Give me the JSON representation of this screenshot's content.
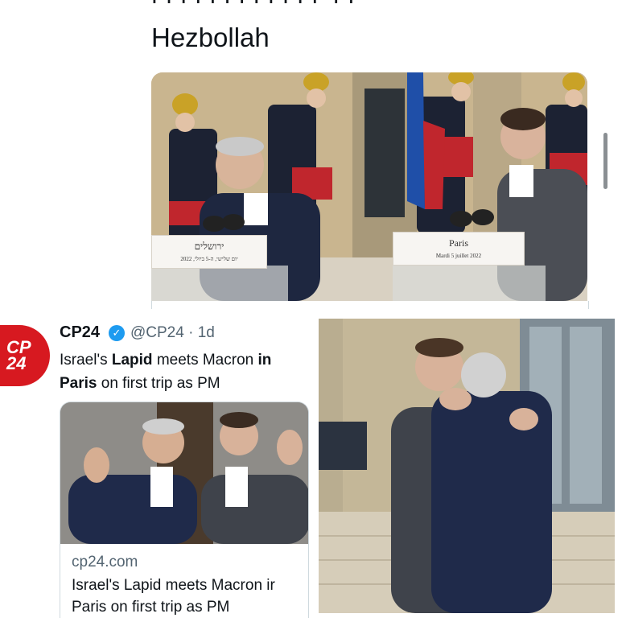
{
  "top_post": {
    "headline": "Hezbollah",
    "photo_signs": {
      "left_line1": "ירושלים",
      "left_line2": "2022 ,יום שלישי, ה-5 ביולי",
      "right_line1": "Paris",
      "right_line2": "Mardi 5 juillet 2022"
    }
  },
  "tweet": {
    "logo_text": "CP 24",
    "author_name": "CP24",
    "verified_icon": "verified-badge-icon",
    "handle_time": "@CP24 · 1d",
    "text_part1": "Israel's ",
    "text_bold1": "Lapid",
    "text_part2": " meets Macron ",
    "text_bold2": "in",
    "text_bold3": "Paris",
    "text_part3": " on first trip as PM",
    "card": {
      "domain": "cp24.com",
      "title_line1": "Israel's Lapid meets Macron ir",
      "title_line2": "Paris on first trip as PM"
    }
  },
  "colors": {
    "brand_red": "#d71920",
    "verified_blue": "#1d9bf0",
    "secondary_text": "#536471",
    "border": "#cfd9de"
  }
}
